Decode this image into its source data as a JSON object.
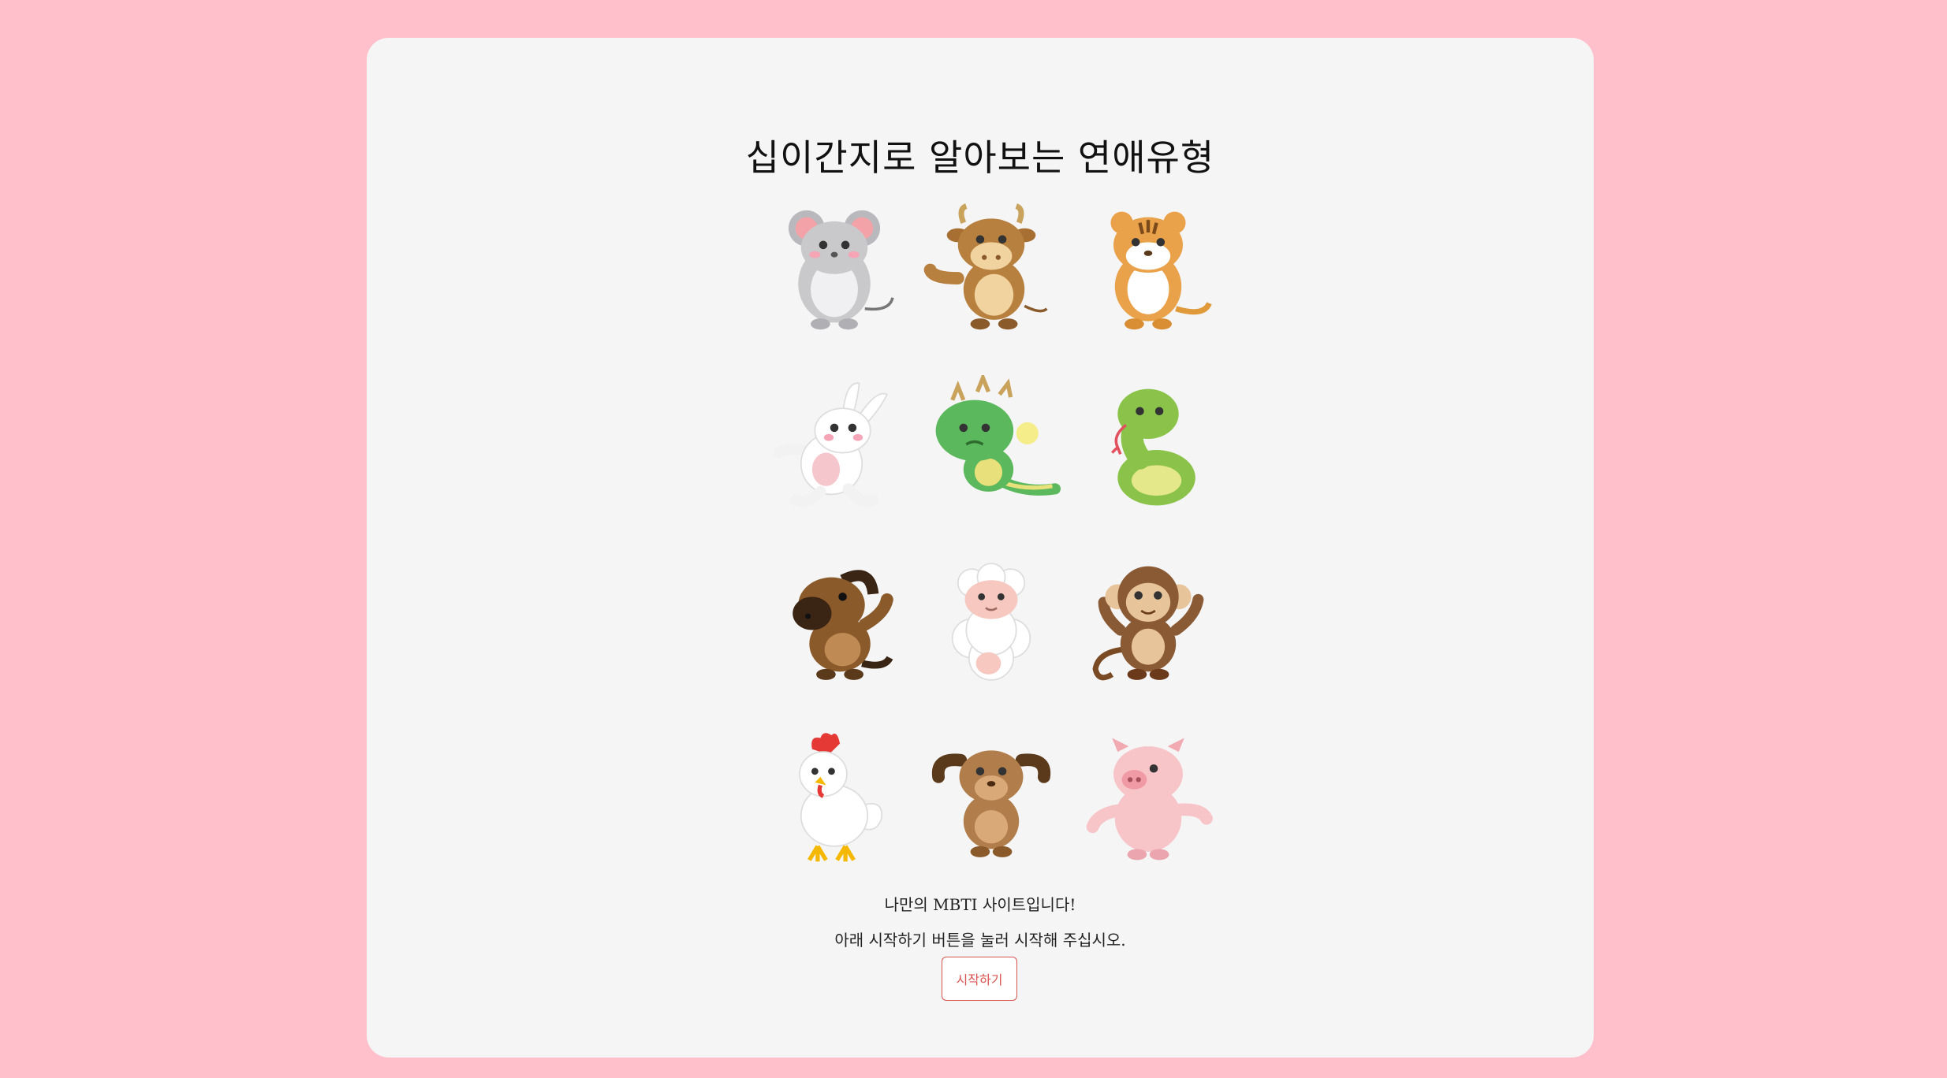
{
  "title": "십이간지로 알아보는 연애유형",
  "animals": [
    {
      "icon": "rat-icon",
      "color": "#c9c9cc"
    },
    {
      "icon": "ox-icon",
      "color": "#b8803e"
    },
    {
      "icon": "tiger-icon",
      "color": "#e9a24a"
    },
    {
      "icon": "rabbit-icon",
      "color": "#ffffff"
    },
    {
      "icon": "dragon-icon",
      "color": "#5cb85c"
    },
    {
      "icon": "snake-icon",
      "color": "#8bc34a"
    },
    {
      "icon": "horse-icon",
      "color": "#8b5a2b"
    },
    {
      "icon": "sheep-icon",
      "color": "#ffffff"
    },
    {
      "icon": "monkey-icon",
      "color": "#8a5a34"
    },
    {
      "icon": "rooster-icon",
      "color": "#ffffff"
    },
    {
      "icon": "dog-icon",
      "color": "#b07d4b"
    },
    {
      "icon": "pig-icon",
      "color": "#f7c4c8"
    }
  ],
  "description": {
    "line1": "나만의 MBTI 사이트입니다!",
    "line2": "아래 시작하기 버튼을 눌러 시작해 주십시오."
  },
  "start_button": {
    "label": "시작하기"
  },
  "colors": {
    "page_bg": "#ffc0cb",
    "card_bg": "#f5f5f5",
    "accent": "#d9534f"
  }
}
